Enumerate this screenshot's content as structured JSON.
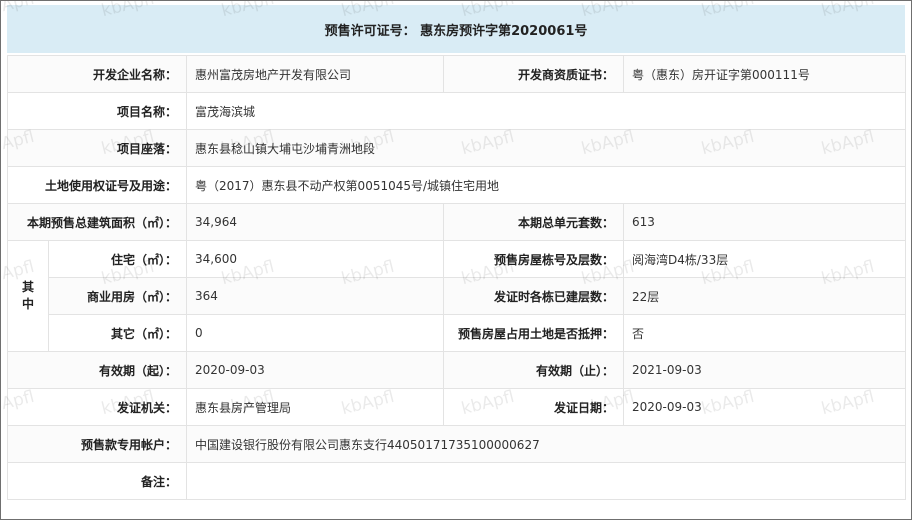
{
  "title": "预售许可证号： 惠东房预许字第2020061号",
  "rows": {
    "developer": {
      "label": "开发企业名称：",
      "value": "惠州富茂房地产开发有限公司"
    },
    "qualification": {
      "label": "开发商资质证书：",
      "value": "粤（惠东）房开证字第000111号"
    },
    "project_name": {
      "label": "项目名称：",
      "value": "富茂海滨城"
    },
    "project_location": {
      "label": "项目座落：",
      "value": "惠东县稔山镇大埔屯沙埔青洲地段"
    },
    "land_use": {
      "label": "土地使用权证号及用途：",
      "value": "粤（2017）惠东县不动产权第0051045号/城镇住宅用地"
    },
    "total_area": {
      "label": "本期预售总建筑面积（㎡）：",
      "value": "34,964"
    },
    "total_units": {
      "label": "本期总单元套数：",
      "value": "613"
    },
    "qizhong": "其\n中",
    "residential": {
      "label": "住宅（㎡）：",
      "value": "34,600"
    },
    "building_floors": {
      "label": "预售房屋栋号及层数：",
      "value": "阅海湾D4栋/33层"
    },
    "commercial": {
      "label": "商业用房（㎡）：",
      "value": "364"
    },
    "built_floors": {
      "label": "发证时各栋已建层数：",
      "value": "22层"
    },
    "other": {
      "label": "其它（㎡）：",
      "value": "0"
    },
    "mortgaged": {
      "label": "预售房屋占用土地是否抵押：",
      "value": "否"
    },
    "valid_from": {
      "label": "有效期（起）：",
      "value": "2020-09-03"
    },
    "valid_to": {
      "label": "有效期（止）：",
      "value": "2021-09-03"
    },
    "issuer": {
      "label": "发证机关：",
      "value": "惠东县房产管理局"
    },
    "issue_date": {
      "label": "发证日期：",
      "value": "2020-09-03"
    },
    "account": {
      "label": "预售款专用帐户：",
      "value": "中国建设银行股份有限公司惠东支行44050171735100000627"
    },
    "remarks": {
      "label": "备注：",
      "value": ""
    }
  },
  "watermark": "kbApfl"
}
